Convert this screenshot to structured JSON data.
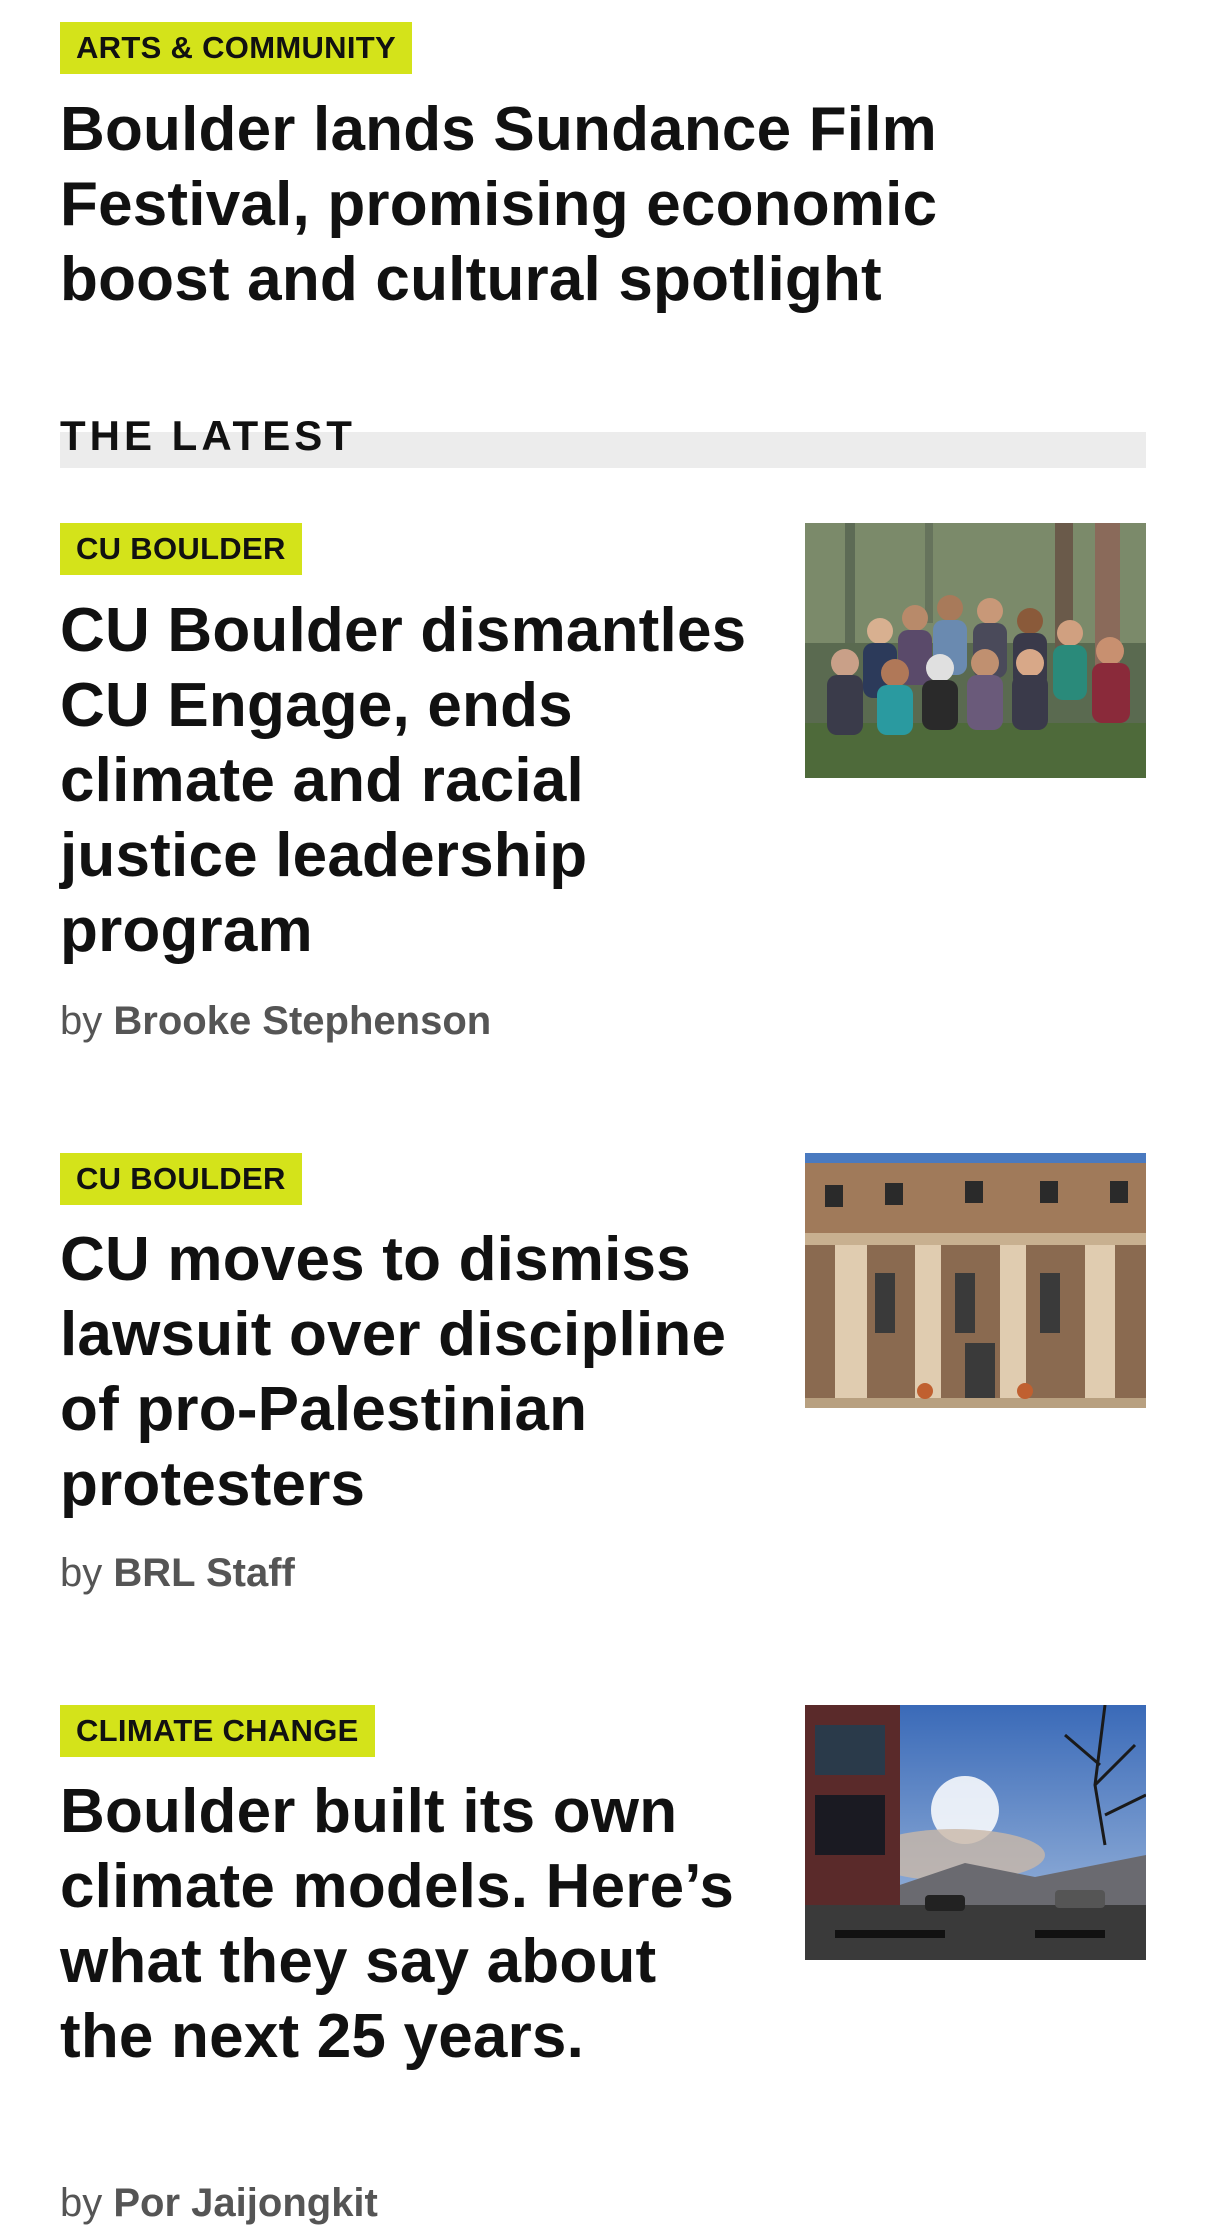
{
  "featured": {
    "tag": "ARTS & COMMUNITY",
    "headline": "Boulder lands Sundance Film Festival, promising economic boost and cultural spotlight"
  },
  "section": {
    "title": "THE LATEST"
  },
  "by_prefix": "by",
  "articles": [
    {
      "tag": "CU BOULDER",
      "headline": "CU Boulder dismantles CU Engage, ends climate and racial justice leadership program",
      "author": "Brooke Stephenson",
      "image": "group-photo-in-forest"
    },
    {
      "tag": "CU BOULDER",
      "headline": "CU moves to dismiss lawsuit over discipline of pro-Palestinian protesters",
      "author": "BRL Staff",
      "image": "university-building-columns"
    },
    {
      "tag": "CLIMATE CHANGE",
      "headline": "Boulder built its own climate models. Here’s what they say about the next 25 years.",
      "author": "Por Jaijongkit",
      "image": "street-with-wildfire-smoke"
    }
  ],
  "colors": {
    "tag_background": "#d4e31a",
    "text": "#111111",
    "byline": "#555555",
    "rule": "#ececec"
  }
}
